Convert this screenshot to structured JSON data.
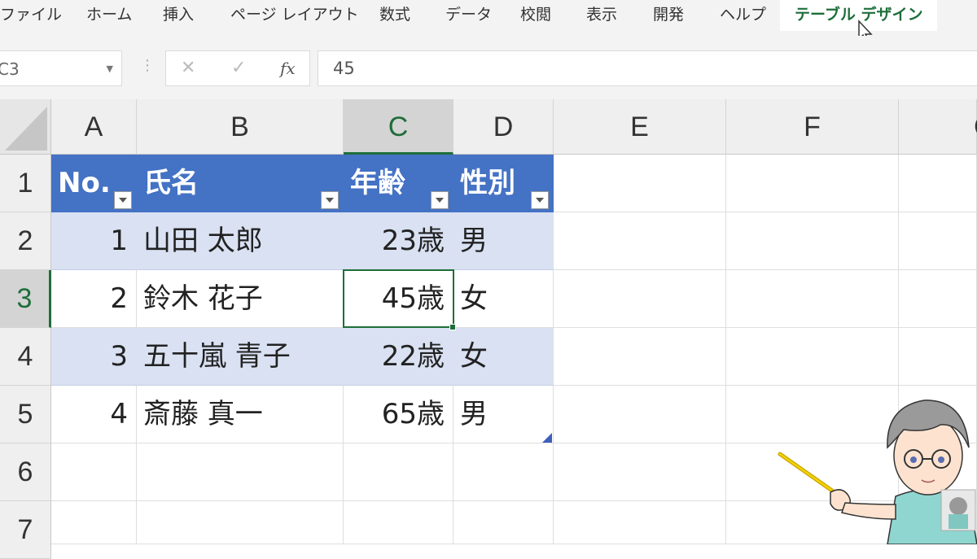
{
  "ribbon": {
    "tabs": [
      "ファイル",
      "ホーム",
      "挿入",
      "ページ レイアウト",
      "数式",
      "データ",
      "校閲",
      "表示",
      "開発",
      "ヘルプ",
      "テーブル デザイン"
    ]
  },
  "formula_bar": {
    "name_box": "C3",
    "cancel_icon": "✕",
    "enter_icon": "✓",
    "fx_label": "fx",
    "value": "45"
  },
  "columns": [
    "A",
    "B",
    "C",
    "D",
    "E",
    "F",
    "G"
  ],
  "rows": [
    "1",
    "2",
    "3",
    "4",
    "5",
    "6",
    "7"
  ],
  "table": {
    "headers": [
      "No.",
      "氏名",
      "年齢",
      "性別"
    ],
    "rows": [
      [
        "1",
        "山田 太郎",
        "23歳",
        "男"
      ],
      [
        "2",
        "鈴木 花子",
        "45歳",
        "女"
      ],
      [
        "3",
        "五十嵐 青子",
        "22歳",
        "女"
      ],
      [
        "4",
        "斎藤 真一",
        "65歳",
        "男"
      ]
    ]
  },
  "colors": {
    "header_blue": "#4472c4",
    "band_blue": "#d9e1f2",
    "excel_green": "#1e6e3a"
  }
}
